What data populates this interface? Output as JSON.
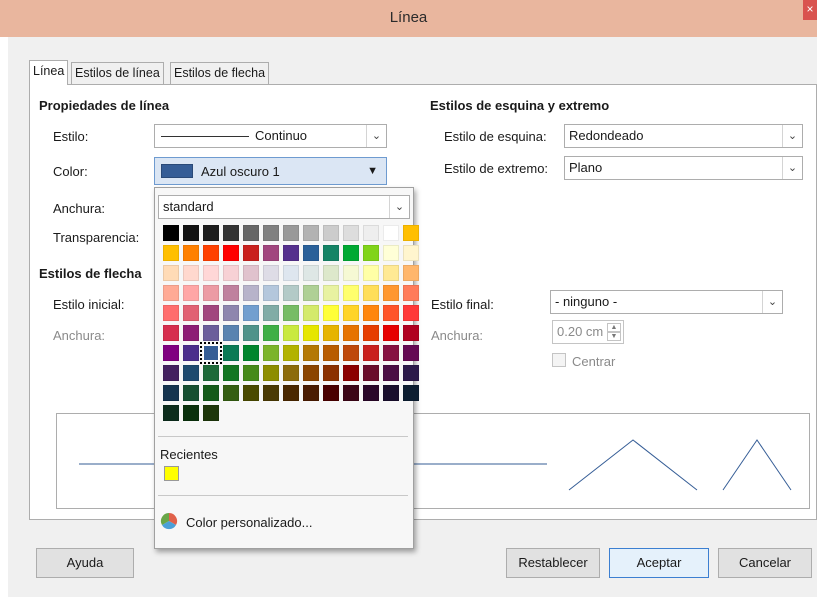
{
  "window": {
    "title": "Línea",
    "close_glyph": "×"
  },
  "tabs": [
    {
      "label": "Línea",
      "active": true
    },
    {
      "label": "Estilos de línea",
      "active": false
    },
    {
      "label": "Estilos de flecha",
      "active": false
    }
  ],
  "line_props": {
    "heading": "Propiedades de línea",
    "style_label": "Estilo:",
    "style_value": "Continuo",
    "color_label": "Color:",
    "color_value": "Azul oscuro 1",
    "color_swatch": "#355d96",
    "width_label": "Anchura:",
    "transparency_label": "Transparencia:"
  },
  "corner_styles": {
    "heading": "Estilos de esquina y extremo",
    "corner_label": "Estilo de esquina:",
    "corner_value": "Redondeado",
    "cap_label": "Estilo de extremo:",
    "cap_value": "Plano"
  },
  "arrow_styles": {
    "heading": "Estilos de flecha",
    "start_label": "Estilo inicial:",
    "start_width_label": "Anchura:",
    "end_label": "Estilo final:",
    "end_value": "- ninguno -",
    "end_width_label": "Anchura:",
    "end_width_value": "0.20 cm",
    "center_label": "Centrar"
  },
  "color_popup": {
    "palette_name": "standard",
    "recent_label": "Recientes",
    "recent_colors": [
      "#ffff00"
    ],
    "custom_label": "Color personalizado...",
    "selected_color": "#355d96",
    "colors": [
      [
        "#000000",
        "#111111",
        "#1c1c1c",
        "#333333",
        "#666666",
        "#808080",
        "#999999",
        "#b2b2b2",
        "#cccccc",
        "#dddddd",
        "#eeeeee",
        "#ffffff"
      ],
      [
        "#ffbf00",
        "#ffbf00",
        "#ff8000",
        "#ff4000",
        "#ff0000",
        "#c9211e",
        "#a1467e",
        "#55308d",
        "#2a6099",
        "#158466",
        "#00a933",
        "#81d41a"
      ],
      [
        "#ffffd7",
        "#fff5ce",
        "#ffdbb6",
        "#ffd8ce",
        "#ffd7d7",
        "#f7d1d5",
        "#e0c2cd",
        "#dedce6",
        "#dee6ef",
        "#dee7e5",
        "#dde8cb",
        "#f6f9d4"
      ],
      [
        "#ffffa6",
        "#ffe994",
        "#ffb66c",
        "#ffaa95",
        "#ffa6a6",
        "#ec9ba4",
        "#bf819e",
        "#b7b3ca",
        "#b4c7dc",
        "#b3cac7",
        "#afd095",
        "#e8f2a1"
      ],
      [
        "#ffff6d",
        "#ffde59",
        "#ff972f",
        "#ff7b59",
        "#ff6d6d",
        "#e16173",
        "#a1467e",
        "#8e86ae",
        "#729fcf",
        "#81aca6",
        "#77bc65",
        "#d4ea6b"
      ],
      [
        "#ffff38",
        "#ffd428",
        "#ff860d",
        "#ff5429",
        "#ff3838",
        "#d62e4e",
        "#8d1d75",
        "#6b5e9b",
        "#5983b0",
        "#50938a",
        "#3faf46",
        "#c9e93f"
      ],
      [
        "#e6e600",
        "#e6b400",
        "#e67300",
        "#e63d00",
        "#e60000",
        "#b00020",
        "#800080",
        "#4b2e8c",
        "#355d96",
        "#0a7a55",
        "#00852d",
        "#7cb42b"
      ],
      [
        "#b2b200",
        "#b47804",
        "#b85c00",
        "#be480a",
        "#c9211e",
        "#861141",
        "#650953",
        "#43215f",
        "#1e4a6e",
        "#1e6a39",
        "#127622",
        "#468a1a"
      ],
      [
        "#8d8d00",
        "#8c6b0b",
        "#8b4500",
        "#8b3100",
        "#8b0000",
        "#6a0d2b",
        "#4b0e44",
        "#2c1a4a",
        "#15344f",
        "#164f31",
        "#145a19",
        "#355e12"
      ],
      [
        "#4a4a00",
        "#4a3a04",
        "#4a2800",
        "#4a1c02",
        "#4a0000",
        "#3c0617",
        "#2a0729",
        "#1a0f2d",
        "#0d1e31",
        "#0d2d1d",
        "#0a310d",
        "#1e370b"
      ]
    ]
  },
  "buttons": {
    "help": "Ayuda",
    "reset": "Restablecer",
    "ok": "Aceptar",
    "cancel": "Cancelar"
  }
}
